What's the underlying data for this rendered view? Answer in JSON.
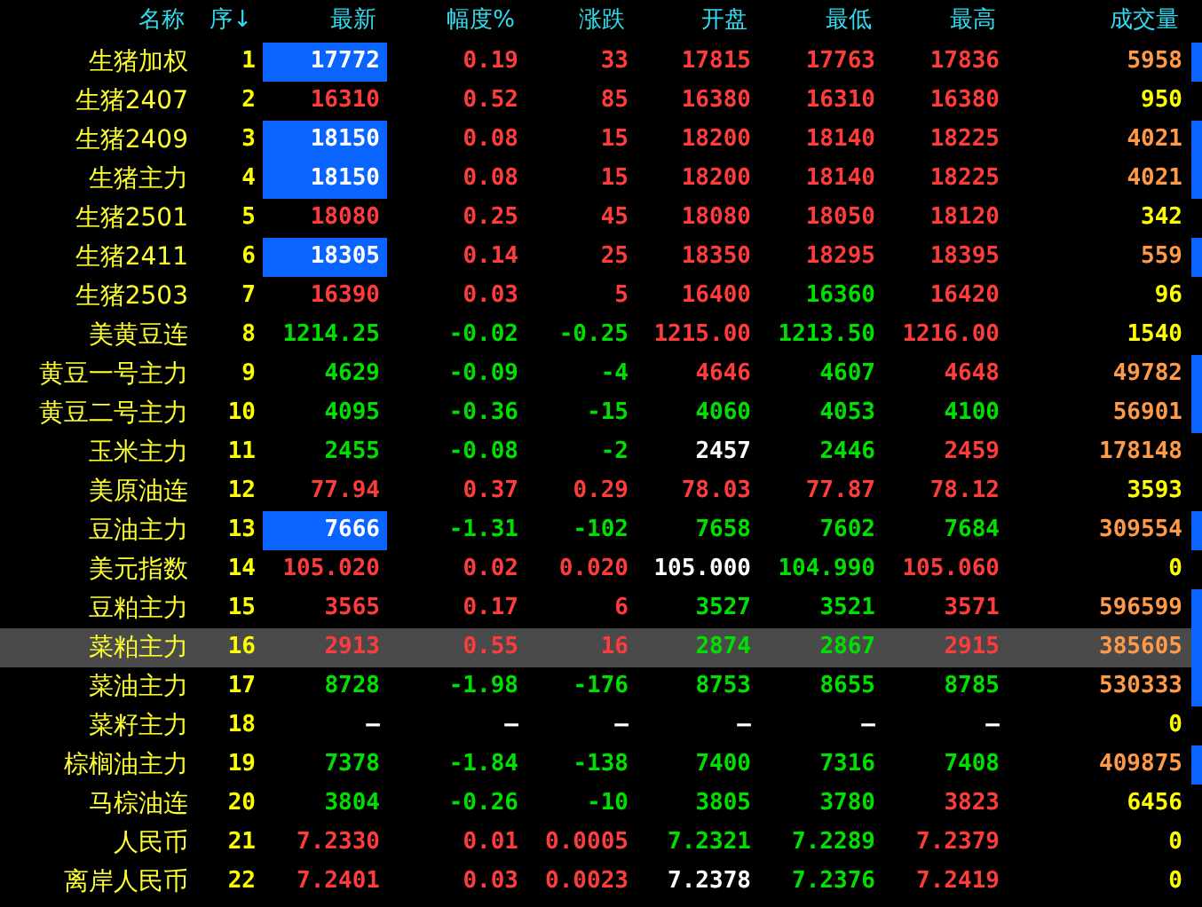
{
  "columns": [
    "名称",
    "序↓",
    "最新",
    "幅度%",
    "涨跌",
    "开盘",
    "最低",
    "最高",
    "成交量"
  ],
  "rows": [
    {
      "name": "生猪加权",
      "seq": "1",
      "highlighted": true,
      "marked": true,
      "selected": false,
      "cells": [
        {
          "text": "17772",
          "color": "#ffffff"
        },
        {
          "text": "0.19",
          "color": "#ff3c3c"
        },
        {
          "text": "33",
          "color": "#ff3c3c"
        },
        {
          "text": "17815",
          "color": "#ff3c3c"
        },
        {
          "text": "17763",
          "color": "#ff3c3c"
        },
        {
          "text": "17836",
          "color": "#ff3c3c"
        },
        {
          "text": "5958",
          "color": "#ff9a48"
        }
      ]
    },
    {
      "name": "生猪2407",
      "seq": "2",
      "highlighted": false,
      "marked": false,
      "selected": false,
      "cells": [
        {
          "text": "16310",
          "color": "#ff3c3c"
        },
        {
          "text": "0.52",
          "color": "#ff3c3c"
        },
        {
          "text": "85",
          "color": "#ff3c3c"
        },
        {
          "text": "16380",
          "color": "#ff3c3c"
        },
        {
          "text": "16310",
          "color": "#ff3c3c"
        },
        {
          "text": "16380",
          "color": "#ff3c3c"
        },
        {
          "text": "950",
          "color": "#ffff00"
        }
      ]
    },
    {
      "name": "生猪2409",
      "seq": "3",
      "highlighted": true,
      "marked": true,
      "selected": false,
      "cells": [
        {
          "text": "18150",
          "color": "#ffffff"
        },
        {
          "text": "0.08",
          "color": "#ff3c3c"
        },
        {
          "text": "15",
          "color": "#ff3c3c"
        },
        {
          "text": "18200",
          "color": "#ff3c3c"
        },
        {
          "text": "18140",
          "color": "#ff3c3c"
        },
        {
          "text": "18225",
          "color": "#ff3c3c"
        },
        {
          "text": "4021",
          "color": "#ff9a48"
        }
      ]
    },
    {
      "name": "生猪主力",
      "seq": "4",
      "highlighted": true,
      "marked": true,
      "selected": false,
      "cells": [
        {
          "text": "18150",
          "color": "#ffffff"
        },
        {
          "text": "0.08",
          "color": "#ff3c3c"
        },
        {
          "text": "15",
          "color": "#ff3c3c"
        },
        {
          "text": "18200",
          "color": "#ff3c3c"
        },
        {
          "text": "18140",
          "color": "#ff3c3c"
        },
        {
          "text": "18225",
          "color": "#ff3c3c"
        },
        {
          "text": "4021",
          "color": "#ff9a48"
        }
      ]
    },
    {
      "name": "生猪2501",
      "seq": "5",
      "highlighted": false,
      "marked": false,
      "selected": false,
      "cells": [
        {
          "text": "18080",
          "color": "#ff3c3c"
        },
        {
          "text": "0.25",
          "color": "#ff3c3c"
        },
        {
          "text": "45",
          "color": "#ff3c3c"
        },
        {
          "text": "18080",
          "color": "#ff3c3c"
        },
        {
          "text": "18050",
          "color": "#ff3c3c"
        },
        {
          "text": "18120",
          "color": "#ff3c3c"
        },
        {
          "text": "342",
          "color": "#ffff00"
        }
      ]
    },
    {
      "name": "生猪2411",
      "seq": "6",
      "highlighted": true,
      "marked": true,
      "selected": false,
      "cells": [
        {
          "text": "18305",
          "color": "#ffffff"
        },
        {
          "text": "0.14",
          "color": "#ff3c3c"
        },
        {
          "text": "25",
          "color": "#ff3c3c"
        },
        {
          "text": "18350",
          "color": "#ff3c3c"
        },
        {
          "text": "18295",
          "color": "#ff3c3c"
        },
        {
          "text": "18395",
          "color": "#ff3c3c"
        },
        {
          "text": "559",
          "color": "#ff9a48"
        }
      ]
    },
    {
      "name": "生猪2503",
      "seq": "7",
      "highlighted": false,
      "marked": false,
      "selected": false,
      "cells": [
        {
          "text": "16390",
          "color": "#ff3c3c"
        },
        {
          "text": "0.03",
          "color": "#ff3c3c"
        },
        {
          "text": "5",
          "color": "#ff3c3c"
        },
        {
          "text": "16400",
          "color": "#ff3c3c"
        },
        {
          "text": "16360",
          "color": "#00e000"
        },
        {
          "text": "16420",
          "color": "#ff3c3c"
        },
        {
          "text": "96",
          "color": "#ffff00"
        }
      ]
    },
    {
      "name": "美黄豆连",
      "seq": "8",
      "highlighted": false,
      "marked": false,
      "selected": false,
      "cells": [
        {
          "text": "1214.25",
          "color": "#00e000"
        },
        {
          "text": "-0.02",
          "color": "#00e000"
        },
        {
          "text": "-0.25",
          "color": "#00e000"
        },
        {
          "text": "1215.00",
          "color": "#ff3c3c"
        },
        {
          "text": "1213.50",
          "color": "#00e000"
        },
        {
          "text": "1216.00",
          "color": "#ff3c3c"
        },
        {
          "text": "1540",
          "color": "#ffff00"
        }
      ]
    },
    {
      "name": "黄豆一号主力",
      "seq": "9",
      "highlighted": false,
      "marked": true,
      "selected": false,
      "cells": [
        {
          "text": "4629",
          "color": "#00e000"
        },
        {
          "text": "-0.09",
          "color": "#00e000"
        },
        {
          "text": "-4",
          "color": "#00e000"
        },
        {
          "text": "4646",
          "color": "#ff3c3c"
        },
        {
          "text": "4607",
          "color": "#00e000"
        },
        {
          "text": "4648",
          "color": "#ff3c3c"
        },
        {
          "text": "49782",
          "color": "#ff9a48"
        }
      ]
    },
    {
      "name": "黄豆二号主力",
      "seq": "10",
      "highlighted": false,
      "marked": true,
      "selected": false,
      "cells": [
        {
          "text": "4095",
          "color": "#00e000"
        },
        {
          "text": "-0.36",
          "color": "#00e000"
        },
        {
          "text": "-15",
          "color": "#00e000"
        },
        {
          "text": "4060",
          "color": "#00e000"
        },
        {
          "text": "4053",
          "color": "#00e000"
        },
        {
          "text": "4100",
          "color": "#00e000"
        },
        {
          "text": "56901",
          "color": "#ff9a48"
        }
      ]
    },
    {
      "name": "玉米主力",
      "seq": "11",
      "highlighted": false,
      "marked": false,
      "selected": false,
      "cells": [
        {
          "text": "2455",
          "color": "#00e000"
        },
        {
          "text": "-0.08",
          "color": "#00e000"
        },
        {
          "text": "-2",
          "color": "#00e000"
        },
        {
          "text": "2457",
          "color": "#ffffff"
        },
        {
          "text": "2446",
          "color": "#00e000"
        },
        {
          "text": "2459",
          "color": "#ff3c3c"
        },
        {
          "text": "178148",
          "color": "#ff9a48"
        }
      ]
    },
    {
      "name": "美原油连",
      "seq": "12",
      "highlighted": false,
      "marked": false,
      "selected": false,
      "cells": [
        {
          "text": "77.94",
          "color": "#ff3c3c"
        },
        {
          "text": "0.37",
          "color": "#ff3c3c"
        },
        {
          "text": "0.29",
          "color": "#ff3c3c"
        },
        {
          "text": "78.03",
          "color": "#ff3c3c"
        },
        {
          "text": "77.87",
          "color": "#ff3c3c"
        },
        {
          "text": "78.12",
          "color": "#ff3c3c"
        },
        {
          "text": "3593",
          "color": "#ffff00"
        }
      ]
    },
    {
      "name": "豆油主力",
      "seq": "13",
      "highlighted": true,
      "marked": true,
      "selected": false,
      "cells": [
        {
          "text": "7666",
          "color": "#ffffff"
        },
        {
          "text": "-1.31",
          "color": "#00e000"
        },
        {
          "text": "-102",
          "color": "#00e000"
        },
        {
          "text": "7658",
          "color": "#00e000"
        },
        {
          "text": "7602",
          "color": "#00e000"
        },
        {
          "text": "7684",
          "color": "#00e000"
        },
        {
          "text": "309554",
          "color": "#ff9a48"
        }
      ]
    },
    {
      "name": "美元指数",
      "seq": "14",
      "highlighted": false,
      "marked": false,
      "selected": false,
      "cells": [
        {
          "text": "105.020",
          "color": "#ff3c3c"
        },
        {
          "text": "0.02",
          "color": "#ff3c3c"
        },
        {
          "text": "0.020",
          "color": "#ff3c3c"
        },
        {
          "text": "105.000",
          "color": "#ffffff"
        },
        {
          "text": "104.990",
          "color": "#00e000"
        },
        {
          "text": "105.060",
          "color": "#ff3c3c"
        },
        {
          "text": "0",
          "color": "#ffff00"
        }
      ]
    },
    {
      "name": "豆粕主力",
      "seq": "15",
      "highlighted": false,
      "marked": true,
      "selected": false,
      "cells": [
        {
          "text": "3565",
          "color": "#ff3c3c"
        },
        {
          "text": "0.17",
          "color": "#ff3c3c"
        },
        {
          "text": "6",
          "color": "#ff3c3c"
        },
        {
          "text": "3527",
          "color": "#00e000"
        },
        {
          "text": "3521",
          "color": "#00e000"
        },
        {
          "text": "3571",
          "color": "#ff3c3c"
        },
        {
          "text": "596599",
          "color": "#ff9a48"
        }
      ]
    },
    {
      "name": "菜粕主力",
      "seq": "16",
      "highlighted": false,
      "marked": true,
      "selected": true,
      "cells": [
        {
          "text": "2913",
          "color": "#ff3c3c"
        },
        {
          "text": "0.55",
          "color": "#ff3c3c"
        },
        {
          "text": "16",
          "color": "#ff3c3c"
        },
        {
          "text": "2874",
          "color": "#00e000"
        },
        {
          "text": "2867",
          "color": "#00e000"
        },
        {
          "text": "2915",
          "color": "#ff3c3c"
        },
        {
          "text": "385605",
          "color": "#ff9a48"
        }
      ]
    },
    {
      "name": "菜油主力",
      "seq": "17",
      "highlighted": false,
      "marked": true,
      "selected": false,
      "cells": [
        {
          "text": "8728",
          "color": "#00e000"
        },
        {
          "text": "-1.98",
          "color": "#00e000"
        },
        {
          "text": "-176",
          "color": "#00e000"
        },
        {
          "text": "8753",
          "color": "#00e000"
        },
        {
          "text": "8655",
          "color": "#00e000"
        },
        {
          "text": "8785",
          "color": "#00e000"
        },
        {
          "text": "530333",
          "color": "#ff9a48"
        }
      ]
    },
    {
      "name": "菜籽主力",
      "seq": "18",
      "highlighted": false,
      "marked": false,
      "selected": false,
      "cells": [
        {
          "text": "—",
          "color": "#ffffff"
        },
        {
          "text": "—",
          "color": "#ffffff"
        },
        {
          "text": "—",
          "color": "#ffffff"
        },
        {
          "text": "—",
          "color": "#ffffff"
        },
        {
          "text": "—",
          "color": "#ffffff"
        },
        {
          "text": "—",
          "color": "#ffffff"
        },
        {
          "text": "0",
          "color": "#ffff00"
        }
      ]
    },
    {
      "name": "棕榈油主力",
      "seq": "19",
      "highlighted": false,
      "marked": true,
      "selected": false,
      "cells": [
        {
          "text": "7378",
          "color": "#00e000"
        },
        {
          "text": "-1.84",
          "color": "#00e000"
        },
        {
          "text": "-138",
          "color": "#00e000"
        },
        {
          "text": "7400",
          "color": "#00e000"
        },
        {
          "text": "7316",
          "color": "#00e000"
        },
        {
          "text": "7408",
          "color": "#00e000"
        },
        {
          "text": "409875",
          "color": "#ff9a48"
        }
      ]
    },
    {
      "name": "马棕油连",
      "seq": "20",
      "highlighted": false,
      "marked": false,
      "selected": false,
      "cells": [
        {
          "text": "3804",
          "color": "#00e000"
        },
        {
          "text": "-0.26",
          "color": "#00e000"
        },
        {
          "text": "-10",
          "color": "#00e000"
        },
        {
          "text": "3805",
          "color": "#00e000"
        },
        {
          "text": "3780",
          "color": "#00e000"
        },
        {
          "text": "3823",
          "color": "#ff3c3c"
        },
        {
          "text": "6456",
          "color": "#ffff00"
        }
      ]
    },
    {
      "name": "人民币",
      "seq": "21",
      "highlighted": false,
      "marked": false,
      "selected": false,
      "cells": [
        {
          "text": "7.2330",
          "color": "#ff3c3c"
        },
        {
          "text": "0.01",
          "color": "#ff3c3c"
        },
        {
          "text": "0.0005",
          "color": "#ff3c3c"
        },
        {
          "text": "7.2321",
          "color": "#00e000"
        },
        {
          "text": "7.2289",
          "color": "#00e000"
        },
        {
          "text": "7.2379",
          "color": "#ff3c3c"
        },
        {
          "text": "0",
          "color": "#ffff00"
        }
      ]
    },
    {
      "name": "离岸人民币",
      "seq": "22",
      "highlighted": false,
      "marked": false,
      "selected": false,
      "cells": [
        {
          "text": "7.2401",
          "color": "#ff3c3c"
        },
        {
          "text": "0.03",
          "color": "#ff3c3c"
        },
        {
          "text": "0.0023",
          "color": "#ff3c3c"
        },
        {
          "text": "7.2378",
          "color": "#ffffff"
        },
        {
          "text": "7.2376",
          "color": "#00e000"
        },
        {
          "text": "7.2419",
          "color": "#ff3c3c"
        },
        {
          "text": "0",
          "color": "#ffff00"
        }
      ]
    }
  ]
}
